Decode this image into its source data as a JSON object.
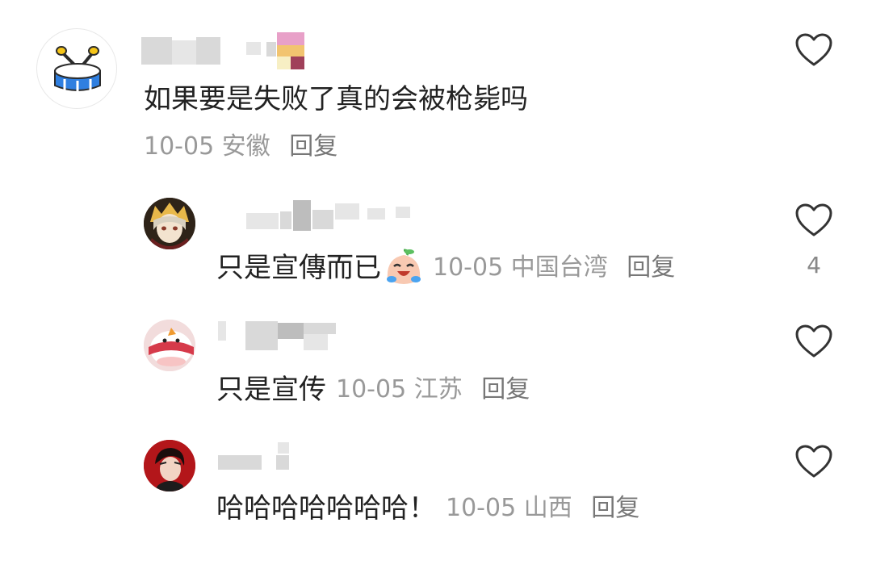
{
  "comments": [
    {
      "text": "如果要是失败了真的会被枪毙吗",
      "date": "10-05",
      "location": "安徽",
      "reply_label": "回复",
      "avatar_icon": "drum-icon"
    },
    {
      "text": "只是宣傳而已",
      "emoji": "crying-laugh-emoji",
      "date": "10-05",
      "location": "中国台湾",
      "reply_label": "回复",
      "likes": "4",
      "avatar_icon": "anime-character-avatar"
    },
    {
      "text": "只是宣传",
      "date": "10-05",
      "location": "江苏",
      "reply_label": "回复",
      "avatar_icon": "pink-character-avatar"
    },
    {
      "text": "哈哈哈哈哈哈哈！",
      "date": "10-05",
      "location": "山西",
      "reply_label": "回复",
      "avatar_icon": "red-portrait-avatar"
    }
  ],
  "colors": {
    "text": "#222222",
    "meta": "#999999",
    "heart": "#333333"
  }
}
